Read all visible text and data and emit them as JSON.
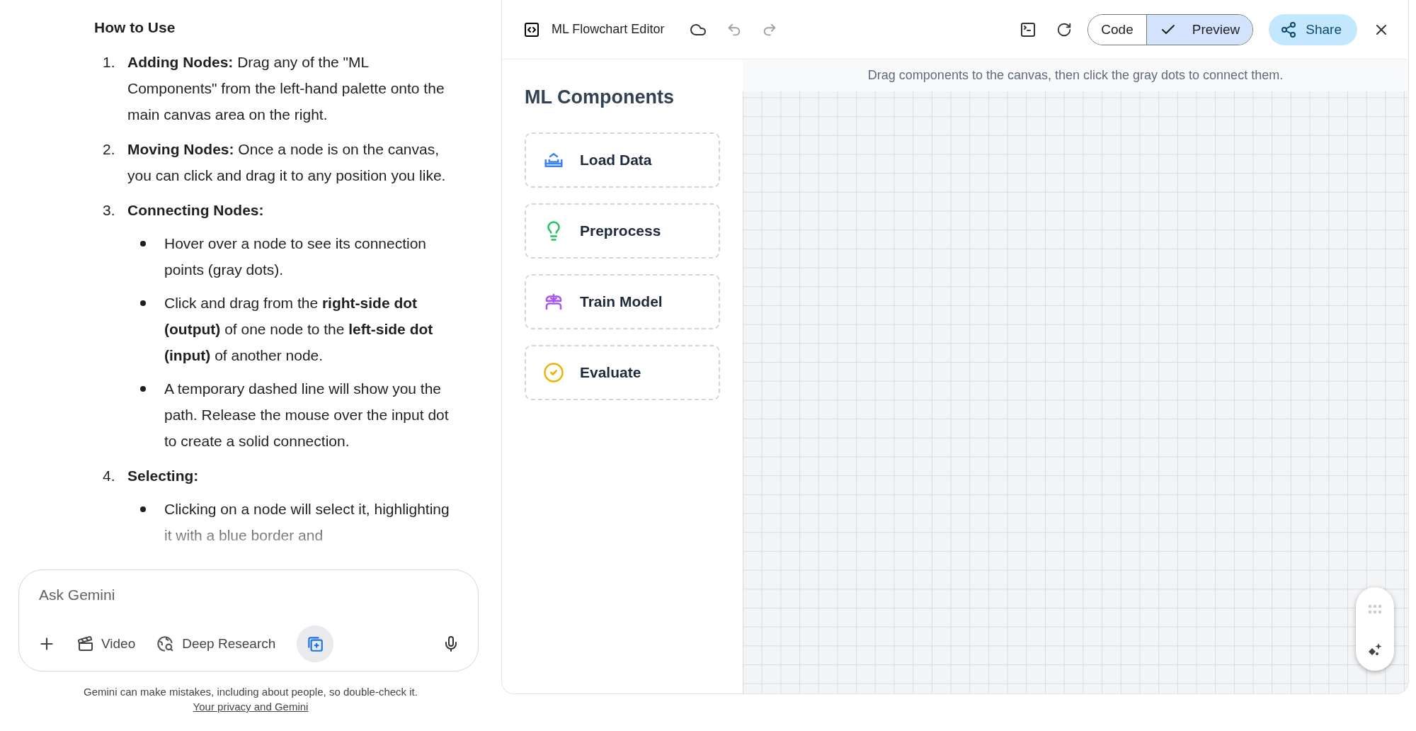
{
  "chat": {
    "heading": "How to Use",
    "steps": [
      {
        "number": "1.",
        "text": "**Adding Nodes:** Drag any of the \"ML Components\" from the left-hand palette onto the main canvas area on the right."
      },
      {
        "number": "2.",
        "text": "**Moving Nodes:** Once a node is on the canvas, you can click and drag it to any position you like."
      },
      {
        "number": "3.",
        "text": "**Connecting Nodes:**",
        "bullets": [
          "Hover over a node to see its connection points (gray dots).",
          "Click and drag from the **right-side dot (output)** of one node to the **left-side dot (input)** of another node.",
          "A temporary dashed line will show you the path. Release the mouse over the input dot to create a solid connection."
        ]
      },
      {
        "number": "4.",
        "text": "**Selecting:**",
        "bullets": [
          "Clicking on a node will select it, highlighting it with a blue border and"
        ]
      }
    ],
    "input": {
      "placeholder": "Ask Gemini"
    },
    "tools": [
      {
        "kind": "add"
      },
      {
        "kind": "video",
        "label": "Video"
      },
      {
        "kind": "research",
        "label": "Deep Research"
      },
      {
        "kind": "canvas",
        "selected": true
      }
    ],
    "disclaimer": "Gemini can make mistakes, including about people, so double-check it.",
    "privacy_link": "Your privacy and Gemini"
  },
  "editor": {
    "title": "ML Flowchart Editor",
    "view_toggle": [
      {
        "label": "Code",
        "selected": false
      },
      {
        "label": "Preview",
        "selected": true
      }
    ],
    "share": "Share",
    "palette_title": "ML Components",
    "components": [
      {
        "kind": "data",
        "label": "Load Data",
        "color": "#3b82f6"
      },
      {
        "kind": "preprocess",
        "label": "Preprocess",
        "color": "#22c55e"
      },
      {
        "kind": "train",
        "label": "Train Model",
        "color": "#a855f7"
      },
      {
        "kind": "evaluate",
        "label": "Evaluate",
        "color": "#eab308"
      }
    ],
    "hint": "Drag components to the canvas, then click the gray dots to connect them."
  }
}
